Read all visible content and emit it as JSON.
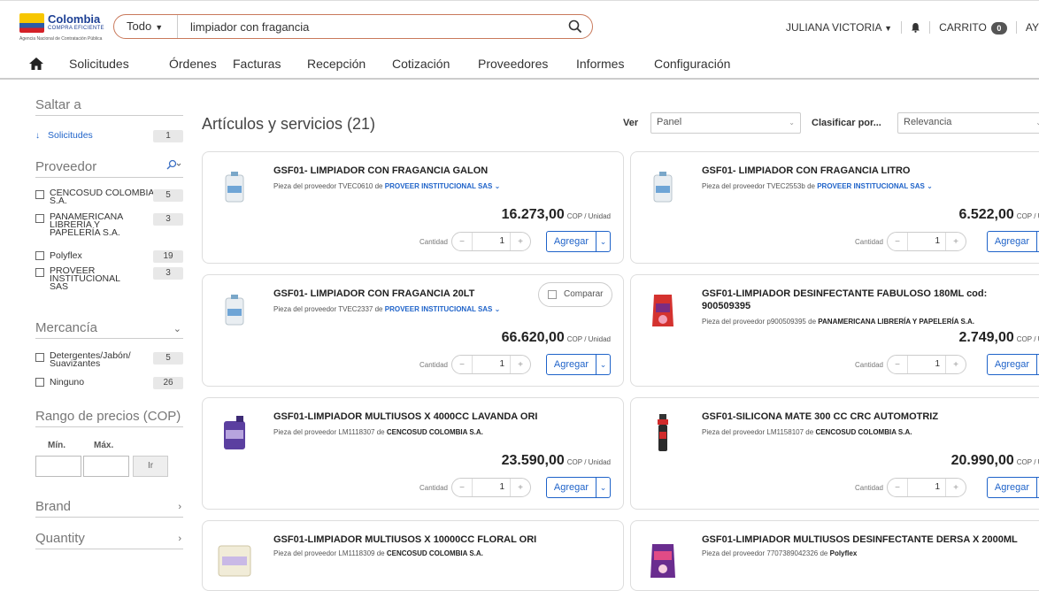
{
  "header": {
    "logo_name": "Colombia",
    "logo_tagline": "COMPRA EFICIENTE",
    "logo_agency": "Agencia Nacional de Contratación Pública",
    "search_scope": "Todo",
    "search_value": "limpiador con fragancia",
    "user_name": "JULIANA VICTORIA",
    "cart_label": "CARRITO",
    "cart_count": "0",
    "help_label": "AYUDA"
  },
  "nav": {
    "items": [
      "Solicitudes",
      "Órdenes",
      "Facturas",
      "Recepción",
      "Cotización",
      "Proveedores",
      "Informes",
      "Configuración"
    ]
  },
  "sidebar": {
    "jump_to": "Saltar a",
    "jump_link": "Solicitudes",
    "jump_count": "1",
    "supplier_head": "Proveedor",
    "suppliers": [
      {
        "label": "CENCOSUD COLOMBIA S.A.",
        "count": "5"
      },
      {
        "label": "PANAMERICANA LIBRERÍA Y PAPELERÍA S.A.",
        "count": "3"
      },
      {
        "label": "Polyflex",
        "count": "19"
      },
      {
        "label": "PROVEER INSTITUCIONAL SAS",
        "count": "3"
      }
    ],
    "goods_head": "Mercancía",
    "goods": [
      {
        "label": "Detergentes/Jabón/ Suavizantes",
        "count": "5"
      },
      {
        "label": "Ninguno",
        "count": "26"
      }
    ],
    "price_head": "Rango de precios (COP)",
    "min_label": "Mín.",
    "max_label": "Máx.",
    "go_label": "Ir",
    "brand_head": "Brand",
    "quantity_head": "Quantity"
  },
  "main": {
    "title": "Artículos y servicios (21)",
    "view_label": "Ver",
    "view_value": "Panel",
    "sort_label": "Clasificar por...",
    "sort_value": "Relevancia",
    "qty_label": "Cantidad",
    "add_label": "Agregar",
    "compare_label": "Comparar",
    "supplier_prefix": "Pieza del proveedor",
    "supplier_mid": "de",
    "unit": "COP / Unidad",
    "products": [
      {
        "title": "GSF01- LIMPIADOR CON FRAGANCIA GALON",
        "code": "TVEC0610",
        "supplier": "PROVEER INSTITUCIONAL SAS",
        "price": "16.273,00",
        "qty": "1"
      },
      {
        "title": "GSF01- LIMPIADOR CON FRAGANCIA LITRO",
        "code": "TVEC2553b",
        "supplier": "PROVEER INSTITUCIONAL SAS",
        "price": "6.522,00",
        "qty": "1"
      },
      {
        "title": "GSF01- LIMPIADOR CON FRAGANCIA 20LT",
        "code": "TVEC2337",
        "supplier": "PROVEER INSTITUCIONAL SAS",
        "price": "66.620,00",
        "qty": "1"
      },
      {
        "title": "GSF01-LIMPIADOR DESINFECTANTE FABULOSO 180ML cod: 900509395",
        "code": "p900509395",
        "supplier": "PANAMERICANA LIBRERÍA Y PAPELERÍA S.A.",
        "price": "2.749,00",
        "qty": "1"
      },
      {
        "title": "GSF01-LIMPIADOR MULTIUSOS X 4000CC LAVANDA ORI",
        "code": "LM1118307",
        "supplier": "CENCOSUD COLOMBIA S.A.",
        "price": "23.590,00",
        "qty": "1"
      },
      {
        "title": "GSF01-SILICONA MATE 300 CC CRC AUTOMOTRIZ",
        "code": "LM1158107",
        "supplier": "CENCOSUD COLOMBIA S.A.",
        "price": "20.990,00",
        "qty": "1"
      },
      {
        "title": "GSF01-LIMPIADOR MULTIUSOS X 10000CC FLORAL ORI",
        "code": "LM1118309",
        "supplier": "CENCOSUD COLOMBIA S.A."
      },
      {
        "title": "GSF01-LIMPIADOR MULTIUSOS DESINFECTANTE DERSA X 2000ML",
        "code": "7707389042326",
        "supplier": "Polyflex"
      }
    ]
  }
}
